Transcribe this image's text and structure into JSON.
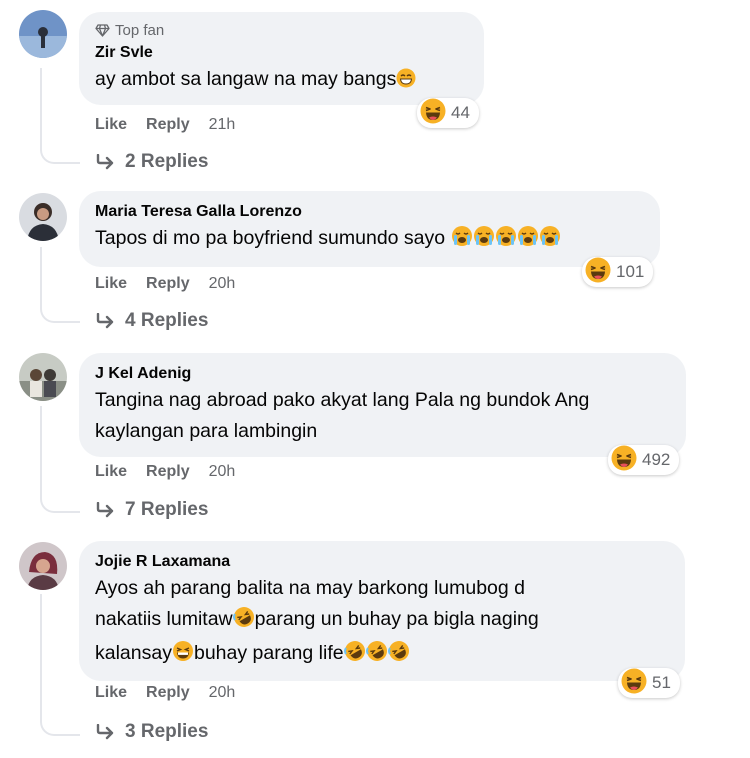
{
  "comments": [
    {
      "badge": "Top fan",
      "author": "Zir Svle",
      "lines": [
        "ay ambot sa langaw na may bangs"
      ],
      "reaction_count": "44",
      "like_label": "Like",
      "reply_label": "Reply",
      "time": "21h",
      "replies_label": "2 Replies"
    },
    {
      "author": "Maria Teresa Galla Lorenzo",
      "lines": [
        "Tapos di mo pa boyfriend sumundo sayo"
      ],
      "reaction_count": "101",
      "like_label": "Like",
      "reply_label": "Reply",
      "time": "20h",
      "replies_label": "4 Replies"
    },
    {
      "author": "J Kel Adenig",
      "lines": [
        "Tangina nag abroad pako akyat lang Pala ng bundok Ang",
        "kaylangan para lambingin"
      ],
      "reaction_count": "492",
      "like_label": "Like",
      "reply_label": "Reply",
      "time": "20h",
      "replies_label": "7 Replies"
    },
    {
      "author": "Jojie R Laxamana",
      "lines": [
        "Ayos ah parang balita na may barkong lumubog d",
        "nakatiis lumitaw",
        "parang un buhay pa bigla naging",
        "kalansay",
        "buhay parang life"
      ],
      "reaction_count": "51",
      "like_label": "Like",
      "reply_label": "Reply",
      "time": "20h",
      "replies_label": "3 Replies"
    }
  ],
  "icons": {
    "badge": "diamond-icon",
    "reaction": "haha-emoji-icon",
    "reply_arrow": "reply-arrow-icon",
    "crying": "loudly-crying-emoji-icon",
    "rofl": "rofl-emoji-icon",
    "grin": "grinning-emoji-icon"
  },
  "colors": {
    "bubble": "#f0f2f5",
    "secondary_text": "#65676b",
    "emoji_yellow": "#f7b125"
  }
}
